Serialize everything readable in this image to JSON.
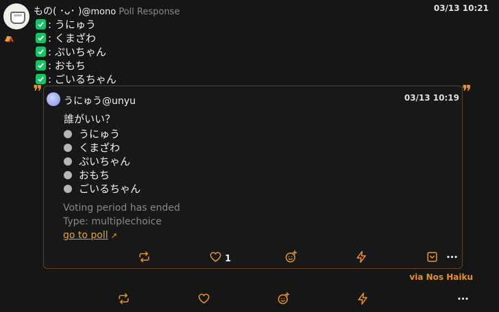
{
  "post": {
    "author_name": "もの( ･ᴗ･ )",
    "author_handle": "@mono",
    "post_kind": "Poll Response",
    "timestamp": "03/13 10:21",
    "choices": [
      {
        "label": ": うにゅう"
      },
      {
        "label": ": くまざわ"
      },
      {
        "label": ": ぷいちゃん"
      },
      {
        "label": ": おもち"
      },
      {
        "label": ": ごいるちゃん"
      }
    ],
    "via": "via Nos Haiku"
  },
  "quote": {
    "author": "うにゅう@unyu",
    "timestamp": "03/13 10:19",
    "question": "誰がいい？",
    "options": [
      {
        "label": "うにゅう"
      },
      {
        "label": "くまざわ"
      },
      {
        "label": "ぷいちゃん"
      },
      {
        "label": "おもち"
      },
      {
        "label": "ごいるちゃん"
      }
    ],
    "status": "Voting period has ended",
    "type": "Type: multiplechoice",
    "link": "go to poll",
    "like_count": "1"
  },
  "colors": {
    "accent": "#e3902d",
    "check": "#17c267",
    "background": "#161616"
  },
  "icons": {
    "repost": "repost-icon",
    "like": "heart-icon",
    "reaction": "emoji-plus-icon",
    "zap": "lightning-icon",
    "bookmark": "bookmark-icon",
    "more": "more-icon",
    "external": "external-link-icon"
  }
}
